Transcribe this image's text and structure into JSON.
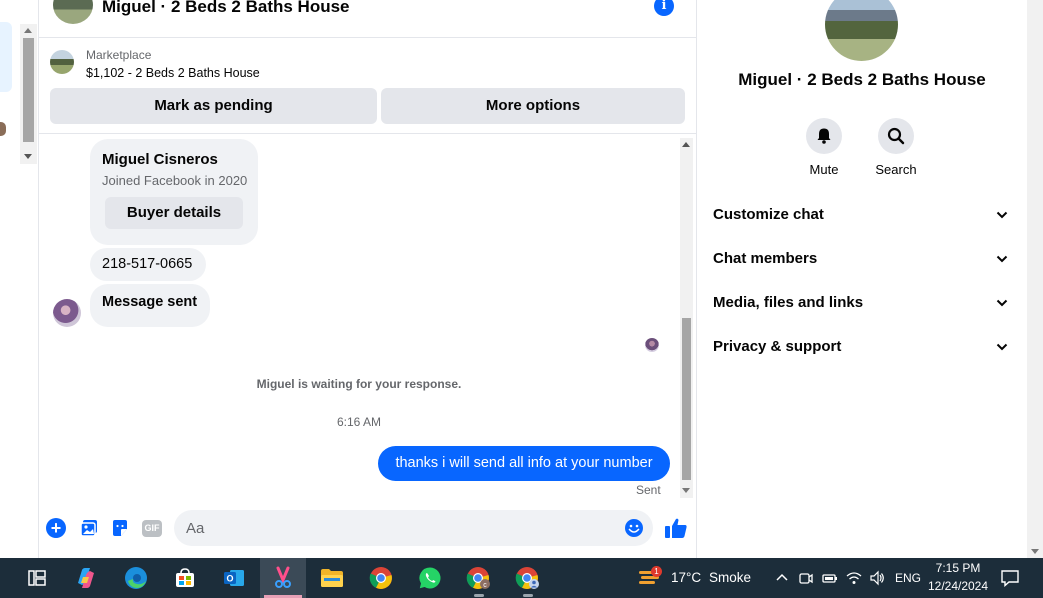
{
  "chat": {
    "title": "Miguel · 2 Beds 2 Baths House",
    "listing": {
      "label": "Marketplace",
      "summary": "$1,102 - 2 Beds 2 Baths House",
      "mark_pending": "Mark as pending",
      "more_options": "More options"
    },
    "messages": {
      "card_name": "Miguel Cisneros",
      "card_joined": "Joined Facebook in 2020",
      "card_button": "Buyer details",
      "phone": "218-517-0665",
      "message_sent": "Message sent",
      "waiting": "Miguel is waiting for your response.",
      "time": "6:16 AM",
      "my_message": "thanks i will send all info at your number",
      "status": "Sent"
    },
    "composer": {
      "placeholder": "Aa",
      "gif_label": "GIF"
    }
  },
  "sidebar": {
    "title": "Miguel · 2 Beds 2 Baths House",
    "actions": {
      "mute": "Mute",
      "search": "Search"
    },
    "rows": {
      "customize": "Customize chat",
      "members": "Chat members",
      "media": "Media, files and links",
      "privacy": "Privacy & support"
    }
  },
  "taskbar": {
    "weather_temp": "17°C",
    "weather_desc": "Smoke",
    "weather_badge": "1",
    "language": "ENG",
    "time": "7:15 PM",
    "date": "12/24/2024"
  },
  "colors": {
    "messenger_blue": "#0866ff",
    "bubble_gray": "#f0f2f5",
    "taskbar": "#1c2d3a"
  }
}
